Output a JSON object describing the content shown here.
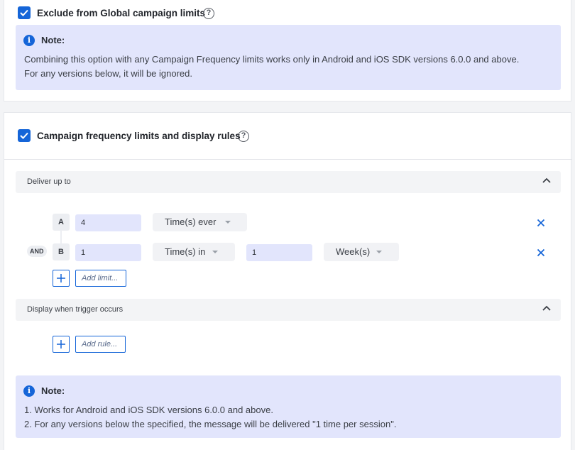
{
  "global_limits": {
    "checkbox_checked": true,
    "label": "Exclude from Global campaign limits",
    "help_icon": "question-circle-icon",
    "note": {
      "icon": "info-icon",
      "title": "Note:",
      "lines": [
        "Combining this option with any Campaign Frequency limits works only in Android and iOS SDK versions 6.0.0 and above.",
        "For any versions below, it will be ignored."
      ]
    }
  },
  "frequency": {
    "checkbox_checked": true,
    "label": "Campaign frequency limits and display rules",
    "help_icon": "question-circle-icon",
    "deliver_section": {
      "label": "Deliver up to",
      "collapse_icon": "chevron-up-icon"
    },
    "limits": [
      {
        "letter": "A",
        "value": "4",
        "unit": "Time(s) ever"
      },
      {
        "letter": "B",
        "value": "1",
        "unit": "Time(s) in",
        "period_value": "1",
        "period_unit": "Week(s)"
      }
    ],
    "and_label": "AND",
    "add_limit_placeholder": "Add limit...",
    "trigger_section": {
      "label": "Display when trigger occurs",
      "collapse_icon": "chevron-up-icon"
    },
    "add_rule_placeholder": "Add rule...",
    "note": {
      "icon": "info-icon",
      "title": "Note:",
      "lines": [
        "1. Works for Android and iOS SDK versions 6.0.0 and above.",
        "2. For any versions below the specified, the message will be delivered \"1 time per session\"."
      ]
    }
  },
  "colors": {
    "accent": "#1565d8",
    "note_bg": "#e2e5fc",
    "section_bg": "#f3f4f6"
  }
}
